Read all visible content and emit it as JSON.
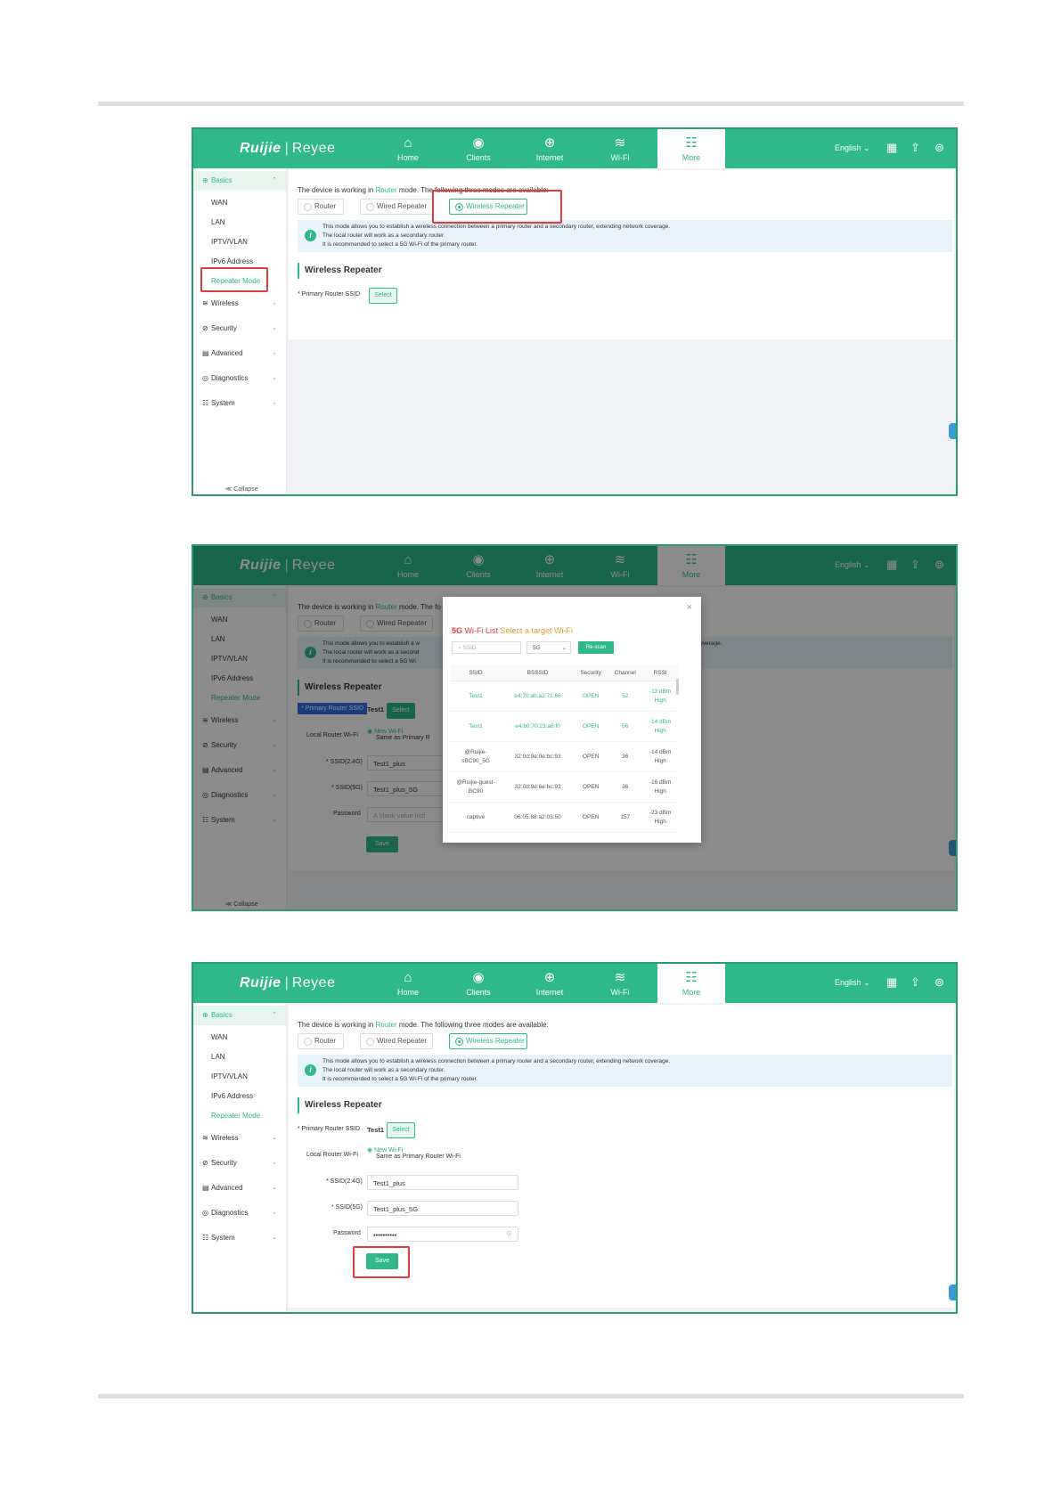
{
  "header": {
    "logo_brand": "Ruijie",
    "logo_sep": "|",
    "logo_product": "Reyee",
    "nav": [
      {
        "label": "Home",
        "icon": "⌂"
      },
      {
        "label": "Clients",
        "icon": "◉"
      },
      {
        "label": "Internet",
        "icon": "⊕"
      },
      {
        "label": "Wi-Fi",
        "icon": "≋"
      },
      {
        "label": "More",
        "icon": "☷"
      }
    ],
    "language": "English ⌄",
    "qr_icon": "▦",
    "upload_icon": "⇪",
    "user_icon": "⊚"
  },
  "sidebar": {
    "basics": "Basics",
    "basics_icon": "⊕",
    "sub_items": [
      "WAN",
      "LAN",
      "IPTV/VLAN",
      "IPv6 Address",
      "Repeater Mode"
    ],
    "groups": [
      {
        "label": "Wireless",
        "icon": "≋"
      },
      {
        "label": "Security",
        "icon": "⊘"
      },
      {
        "label": "Advanced",
        "icon": "▤"
      },
      {
        "label": "Diagnostics",
        "icon": "◎"
      },
      {
        "label": "System",
        "icon": "☷"
      }
    ],
    "chevron_up": "⌃",
    "chevron_down": "⌄",
    "collapse": "≪ Collapse"
  },
  "content": {
    "mode_prefix": "The device is working in ",
    "mode_value": "Router",
    "mode_suffix": " mode. The following three modes are available:",
    "mode_suffix_cut": " mode. The fo",
    "modes": [
      "Router",
      "Wired Repeater",
      "Wireless Repeater"
    ],
    "info_icon": "i",
    "info_bullets": [
      "This mode allows you to establish a wireless connection between a primary router and a secondary router, extending network coverage.",
      "The local router will work as a secondary router.",
      "It is recommended to select a 5G Wi-Fi of the primary router."
    ],
    "info_bullets_cut": [
      "This mode allows you to establish a w",
      "The local router will work as a second",
      "It is recommended to select a 5G Wi"
    ],
    "info_coverage_tail": "coverage.",
    "section_title": "Wireless Repeater",
    "primary_ssid_label": "* Primary Router SSID",
    "primary_ssid_value": "Test1",
    "select_button": "Select",
    "local_wifi_label": "Local Router Wi-Fi",
    "local_wifi_options": [
      "New Wi-Fi",
      "Same as Primary Router Wi-Fi"
    ],
    "local_wifi_option2_cut": "Same as Primary R",
    "ssid24_label": "* SSID(2.4G)",
    "ssid24_value": "Test1_plus",
    "ssid5_label": "* SSID(5G)",
    "ssid5_value": "Test1_plus_5G",
    "password_label": "Password",
    "password_placeholder": "A blank value indi",
    "password_value": "••••••••••",
    "eye_icon": "⊙",
    "save_button": "Save"
  },
  "modal": {
    "close": "×",
    "title_red": "5G",
    "title_black": " Wi-Fi List ",
    "title_orange": "Select a target Wi-Fi",
    "search_icon": "⌕",
    "ssid_placeholder": "SSID",
    "band_value": "5G",
    "rescan_button": "Re-scan",
    "columns": [
      "SSID",
      "BSSSID",
      "Security",
      "Channel",
      "RSSI"
    ],
    "rows": [
      {
        "ssid": "Test1",
        "bssid": "e4:70:ab:a2:71:66",
        "security": "OPEN",
        "channel": "52",
        "rssi": "-11 dBm",
        "quality": "High"
      },
      {
        "ssid": "Test1",
        "bssid": "e4:b0:70:23:a6:f0",
        "security": "OPEN",
        "channel": "56",
        "rssi": "-14 dBm",
        "quality": "High"
      },
      {
        "ssid": "@Ruijie-sBC90_5G",
        "bssid": "32:0d:9e:0e:bc:93",
        "security": "OPEN",
        "channel": "36",
        "rssi": "-14 dBm",
        "quality": "High"
      },
      {
        "ssid": "@Ruijie-guest-BC90",
        "bssid": "32:0d:9e:6e:bc:93",
        "security": "OPEN",
        "channel": "36",
        "rssi": "-16 dBm",
        "quality": "High"
      },
      {
        "ssid": "captive",
        "bssid": "06:05:88:a2:03:50",
        "security": "OPEN",
        "channel": "157",
        "rssi": "-23 dBm",
        "quality": "High"
      }
    ]
  }
}
